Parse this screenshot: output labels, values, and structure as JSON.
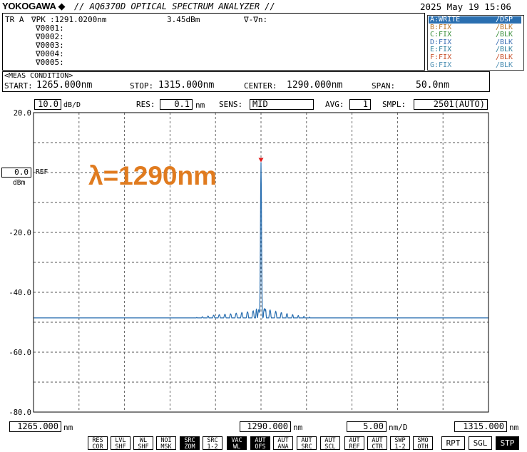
{
  "header": {
    "brand": "YOKOGAWA",
    "brand_mark": "◆",
    "title": "// AQ6370D OPTICAL SPECTRUM ANALYZER //",
    "datetime": "2025 May 19 15:06"
  },
  "marker_panel": {
    "trace_mode": "TR A",
    "peak_label": "∇PK",
    "peak_wavelength": ":1291.0200nm",
    "peak_level": "3.45dBm",
    "delta_label": "∇-∇n:",
    "markers": [
      "∇0001:",
      "∇0002:",
      "∇0003:",
      "∇0004:",
      "∇0005:"
    ]
  },
  "traces": [
    {
      "label": "A:WRITE",
      "mode": "/DSP",
      "color": "#ffffff",
      "active": true
    },
    {
      "label": "B:FIX",
      "mode": "/BLK",
      "color": "#b8762a",
      "active": false
    },
    {
      "label": "C:FIX",
      "mode": "/BLK",
      "color": "#3a8f3a",
      "active": false
    },
    {
      "label": "D:FIX",
      "mode": "/BLK",
      "color": "#3c6fb4",
      "active": false
    },
    {
      "label": "E:FIX",
      "mode": "/BLK",
      "color": "#2e7f9c",
      "active": false
    },
    {
      "label": "F:FIX",
      "mode": "/BLK",
      "color": "#c8502a",
      "active": false
    },
    {
      "label": "G:FIX",
      "mode": "/BLK",
      "color": "#4d8fb3",
      "active": false
    }
  ],
  "meas_condition": {
    "title": "<MEAS CONDITION>",
    "start_label": "START:",
    "start_value": "1265.000nm",
    "stop_label": "STOP:",
    "stop_value": "1315.000nm",
    "center_label": "CENTER:",
    "center_value": "1290.000nm",
    "span_label": "SPAN:",
    "span_value": "50.0nm"
  },
  "settings": {
    "scale_value": "10.0",
    "scale_unit": "dB/D",
    "res_label": "RES:",
    "res_value": "0.1",
    "res_unit": "nm",
    "sens_label": "SENS:",
    "sens_value": "MID",
    "avg_label": "AVG:",
    "avg_value": "1",
    "smpl_label": "SMPL:",
    "smpl_value": "2501(AUTO)"
  },
  "ref": {
    "value": "0.0",
    "unit": "dBm",
    "label": "REF"
  },
  "annotation": {
    "text": "λ=1290nm",
    "color": "#e07b1f"
  },
  "bottom_bar": {
    "start_value": "1265.000",
    "start_unit": "nm",
    "center_value": "1290.000",
    "center_unit": "nm",
    "div_value": "5.00",
    "div_unit": "nm/D",
    "stop_value": "1315.000",
    "stop_unit": "nm"
  },
  "softkeys": [
    {
      "top": "RES",
      "bottom": "COR",
      "on": false
    },
    {
      "top": "LVL",
      "bottom": "SHF",
      "on": false
    },
    {
      "top": "WL",
      "bottom": "SHF",
      "on": false
    },
    {
      "top": "NOI",
      "bottom": "MSK",
      "on": false
    },
    {
      "top": "SRC",
      "bottom": "ZOM",
      "on": true
    },
    {
      "top": "SRC",
      "bottom": "1-2",
      "on": false
    },
    {
      "top": "VAC",
      "bottom": "WL",
      "on": true
    },
    {
      "top": "AUT",
      "bottom": "OFS",
      "on": true
    },
    {
      "top": "AUT",
      "bottom": "ANA",
      "on": false
    },
    {
      "top": "AUT",
      "bottom": "SRC",
      "on": false
    },
    {
      "top": "AUT",
      "bottom": "SCL",
      "on": false
    },
    {
      "top": "AUT",
      "bottom": "REF",
      "on": false
    },
    {
      "top": "AUT",
      "bottom": "CTR",
      "on": false
    },
    {
      "top": "SWP",
      "bottom": "1-2",
      "on": false
    },
    {
      "top": "SMO",
      "bottom": "OTH",
      "on": false
    }
  ],
  "sweep_buttons": [
    {
      "label": "RPT",
      "on": false
    },
    {
      "label": "SGL",
      "on": false
    },
    {
      "label": "STP",
      "on": true
    }
  ],
  "chart_data": {
    "type": "line",
    "x_range": [
      1265.0,
      1315.0
    ],
    "ylim": [
      -80.0,
      20.0
    ],
    "y_ticks": [
      "20.0",
      "",
      "0.0",
      "-20.0",
      "-40.0",
      "-60.0",
      "-80.0"
    ],
    "grid": true,
    "line_color": "#2a6fb0",
    "peak_marker_color": "#e21b1b",
    "peak": {
      "x": 1290.0,
      "y": 3.45
    },
    "baseline": [
      [
        1265.0,
        -55.5
      ],
      [
        1270.0,
        -53.3
      ],
      [
        1275.0,
        -51.8
      ],
      [
        1280.0,
        -50.3
      ],
      [
        1285.0,
        -49.2
      ],
      [
        1290.0,
        -49.5
      ],
      [
        1295.0,
        -50.4
      ],
      [
        1300.0,
        -51.6
      ],
      [
        1305.0,
        -52.2
      ],
      [
        1310.0,
        -52.6
      ],
      [
        1315.0,
        -53.5
      ]
    ]
  }
}
